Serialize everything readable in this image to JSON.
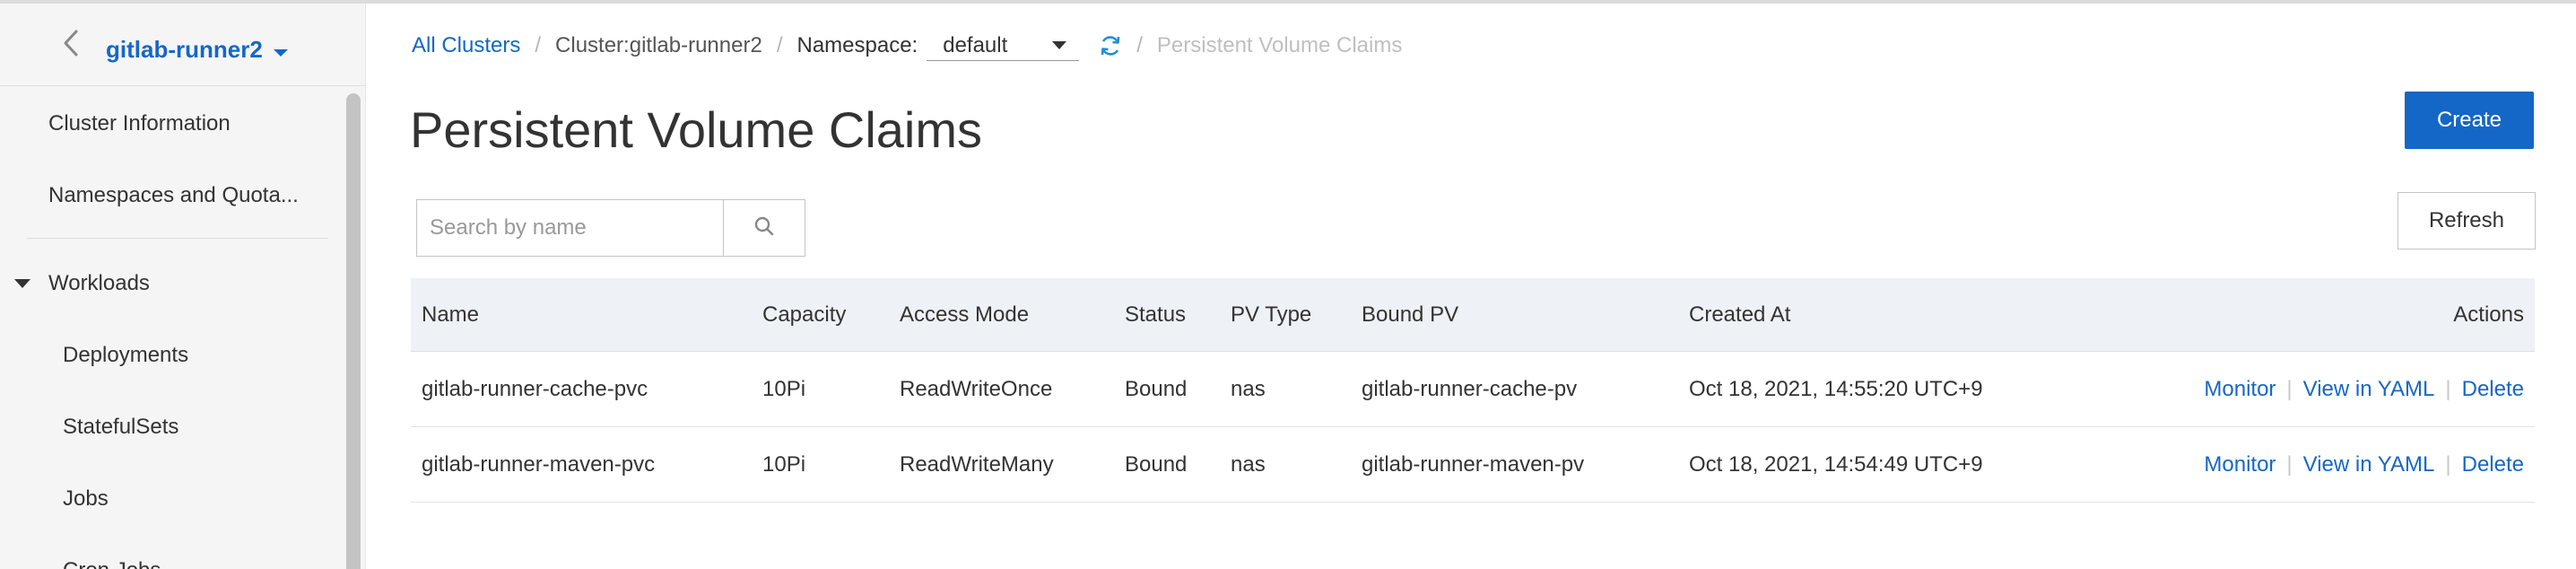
{
  "sidebar": {
    "cluster_name": "gitlab-runner2",
    "items": [
      {
        "label": "Cluster Information"
      },
      {
        "label": "Namespaces and Quota..."
      }
    ],
    "group": {
      "label": "Workloads"
    },
    "sub_items": [
      {
        "label": "Deployments"
      },
      {
        "label": "StatefulSets"
      },
      {
        "label": "Jobs"
      },
      {
        "label": "Cron Jobs"
      }
    ]
  },
  "breadcrumb": {
    "all_clusters": "All Clusters",
    "cluster": "Cluster:gitlab-runner2",
    "namespace_label": "Namespace:",
    "namespace_value": "default",
    "current": "Persistent Volume Claims"
  },
  "page": {
    "title": "Persistent Volume Claims",
    "create_label": "Create",
    "refresh_label": "Refresh",
    "search_placeholder": "Search by name"
  },
  "table": {
    "headers": {
      "name": "Name",
      "capacity": "Capacity",
      "access_mode": "Access Mode",
      "status": "Status",
      "pv_type": "PV Type",
      "bound_pv": "Bound PV",
      "created_at": "Created At",
      "actions": "Actions"
    },
    "rows": [
      {
        "name": "gitlab-runner-cache-pvc",
        "capacity": "10Pi",
        "access_mode": "ReadWriteOnce",
        "status": "Bound",
        "pv_type": "nas",
        "bound_pv": "gitlab-runner-cache-pv",
        "created_at": "Oct 18, 2021, 14:55:20 UTC+9"
      },
      {
        "name": "gitlab-runner-maven-pvc",
        "capacity": "10Pi",
        "access_mode": "ReadWriteMany",
        "status": "Bound",
        "pv_type": "nas",
        "bound_pv": "gitlab-runner-maven-pv",
        "created_at": "Oct 18, 2021, 14:54:49 UTC+9"
      }
    ],
    "actions": {
      "monitor": "Monitor",
      "view_yaml": "View in YAML",
      "delete": "Delete",
      "separator": "|"
    }
  },
  "colors": {
    "primary": "#1467c7",
    "header_bg": "#eef1f5",
    "sidebar_bg": "#f5f5f6"
  },
  "icons": {
    "back": "chevron-left-icon",
    "dropdown": "caret-down-icon",
    "refresh": "refresh-icon",
    "search": "search-icon",
    "expand": "triangle-down-icon"
  }
}
